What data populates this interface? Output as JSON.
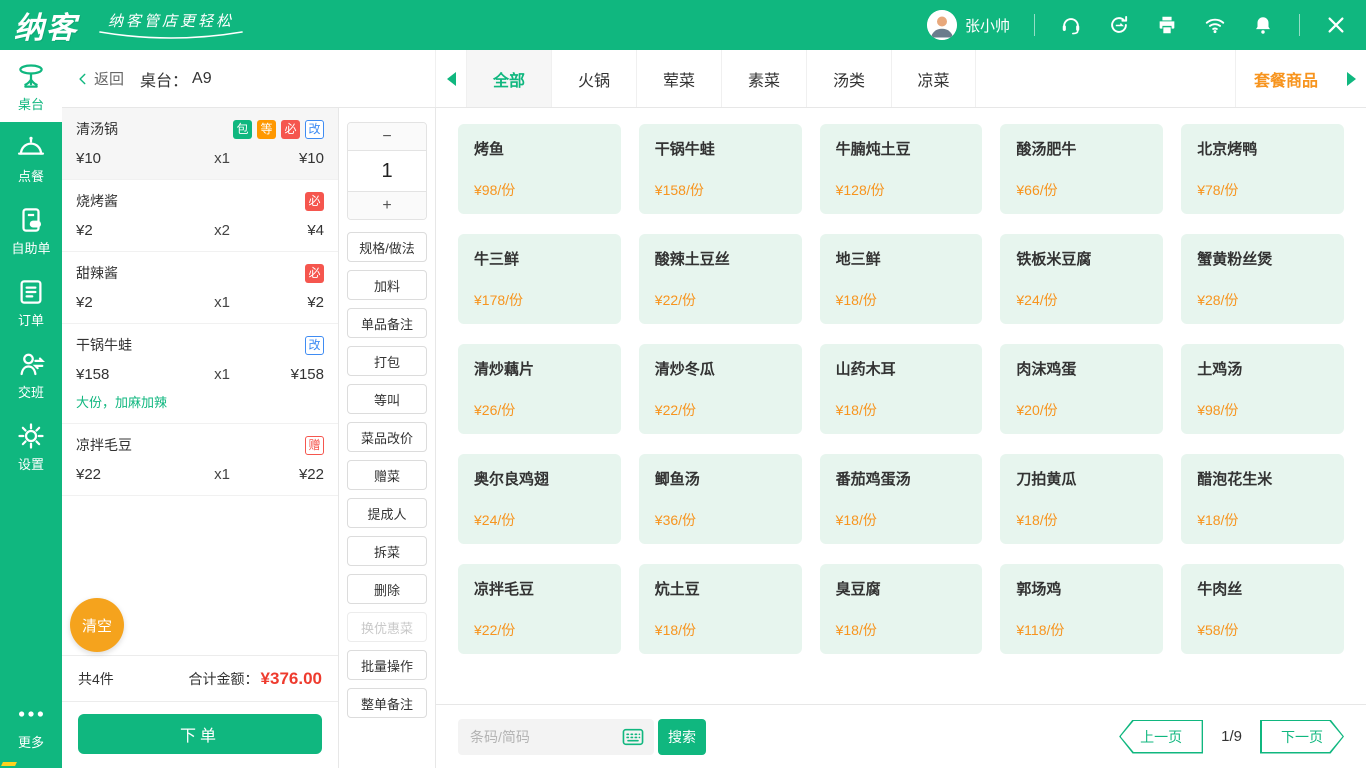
{
  "colors": {
    "accent": "#10b77f",
    "mint": "#e7f5ee",
    "orange": "#f7941e",
    "badge-orange": "#ff9800",
    "amber": "#f5a31d",
    "red": "#ee3b2e",
    "badge-red": "#f5564e",
    "blue": "#3f8cf3",
    "yellow": "#ffd21e"
  },
  "topbar": {
    "brand": "纳客",
    "tagline": "纳客管店更轻松",
    "user": "张小帅",
    "icons": [
      "support-icon",
      "cloud-sync-icon",
      "printer-icon",
      "wifi-icon",
      "bell-icon",
      "close-icon"
    ]
  },
  "sidebar": {
    "items": [
      {
        "id": "table",
        "label": "桌台",
        "icon": "table-icon",
        "active": true
      },
      {
        "id": "order-food",
        "label": "点餐",
        "icon": "cloche-icon",
        "active": false
      },
      {
        "id": "self-order",
        "label": "自助单",
        "icon": "self-order-icon",
        "active": false
      },
      {
        "id": "orders",
        "label": "订单",
        "icon": "order-list-icon",
        "active": false
      },
      {
        "id": "shift",
        "label": "交班",
        "icon": "shift-icon",
        "active": false
      },
      {
        "id": "settings",
        "label": "设置",
        "icon": "gear-icon",
        "active": false
      },
      {
        "id": "more",
        "label": "更多",
        "icon": "more-dots-icon",
        "active": false
      }
    ]
  },
  "header": {
    "back": "返回",
    "table_label": "桌台：",
    "table_value": "A9",
    "tabs": [
      "全部",
      "火锅",
      "荤菜",
      "素菜",
      "汤类",
      "凉菜"
    ],
    "active_tab": "全部",
    "combo": "套餐商品"
  },
  "order": {
    "items": [
      {
        "name": "清汤锅",
        "price": "¥10",
        "qty": "x1",
        "total": "¥10",
        "selected": true,
        "badges": [
          {
            "text": "包",
            "variant": "green"
          },
          {
            "text": "等",
            "variant": "orange"
          },
          {
            "text": "必",
            "variant": "red"
          },
          {
            "text": "改",
            "variant": "blue-o"
          }
        ]
      },
      {
        "name": "烧烤酱",
        "price": "¥2",
        "qty": "x2",
        "total": "¥4",
        "badges": [
          {
            "text": "必",
            "variant": "red"
          }
        ]
      },
      {
        "name": "甜辣酱",
        "price": "¥2",
        "qty": "x1",
        "total": "¥2",
        "badges": [
          {
            "text": "必",
            "variant": "red"
          }
        ]
      },
      {
        "name": "干锅牛蛙",
        "price": "¥158",
        "qty": "x1",
        "total": "¥158",
        "note": "大份，加麻加辣",
        "badges": [
          {
            "text": "改",
            "variant": "blue-o"
          }
        ]
      },
      {
        "name": "凉拌毛豆",
        "price": "¥22",
        "qty": "x1",
        "total": "¥22",
        "badges": [
          {
            "text": "赠",
            "variant": "red-o"
          }
        ]
      }
    ],
    "clear_label": "清空",
    "count_label": "共4件",
    "total_label": "合计金额：",
    "total_value": "¥376.00",
    "submit_label": "下单"
  },
  "actions": {
    "minus": "−",
    "qty": "1",
    "plus": "+",
    "buttons": [
      {
        "label": "规格/做法"
      },
      {
        "label": "加料"
      },
      {
        "label": "单品备注"
      },
      {
        "label": "打包"
      },
      {
        "label": "等叫"
      },
      {
        "label": "菜品改价"
      },
      {
        "label": "赠菜"
      },
      {
        "label": "提成人"
      },
      {
        "label": "拆菜"
      },
      {
        "label": "删除"
      },
      {
        "label": "换优惠菜",
        "disabled": true
      },
      {
        "label": "批量操作"
      },
      {
        "label": "整单备注"
      }
    ]
  },
  "menu": {
    "items": [
      {
        "name": "烤鱼",
        "price": "¥98/份"
      },
      {
        "name": "干锅牛蛙",
        "price": "¥158/份"
      },
      {
        "name": "牛腩炖土豆",
        "price": "¥128/份"
      },
      {
        "name": "酸汤肥牛",
        "price": "¥66/份"
      },
      {
        "name": "北京烤鸭",
        "price": "¥78/份"
      },
      {
        "name": "牛三鲜",
        "price": "¥178/份"
      },
      {
        "name": "酸辣土豆丝",
        "price": "¥22/份"
      },
      {
        "name": "地三鲜",
        "price": "¥18/份"
      },
      {
        "name": "铁板米豆腐",
        "price": "¥24/份"
      },
      {
        "name": "蟹黄粉丝煲",
        "price": "¥28/份"
      },
      {
        "name": "清炒藕片",
        "price": "¥26/份"
      },
      {
        "name": "清炒冬瓜",
        "price": "¥22/份"
      },
      {
        "name": "山药木耳",
        "price": "¥18/份"
      },
      {
        "name": "肉沫鸡蛋",
        "price": "¥20/份"
      },
      {
        "name": "土鸡汤",
        "price": "¥98/份"
      },
      {
        "name": "奥尔良鸡翅",
        "price": "¥24/份"
      },
      {
        "name": "鲫鱼汤",
        "price": "¥36/份"
      },
      {
        "name": "番茄鸡蛋汤",
        "price": "¥18/份"
      },
      {
        "name": "刀拍黄瓜",
        "price": "¥18/份"
      },
      {
        "name": "醋泡花生米",
        "price": "¥18/份"
      },
      {
        "name": "凉拌毛豆",
        "price": "¥22/份"
      },
      {
        "name": "炕土豆",
        "price": "¥18/份"
      },
      {
        "name": "臭豆腐",
        "price": "¥18/份"
      },
      {
        "name": "郭场鸡",
        "price": "¥118/份"
      },
      {
        "name": "牛肉丝",
        "price": "¥58/份"
      }
    ]
  },
  "footer": {
    "search_placeholder": "条码/简码",
    "search_label": "搜索",
    "prev": "上一页",
    "page": "1/9",
    "next": "下一页"
  }
}
